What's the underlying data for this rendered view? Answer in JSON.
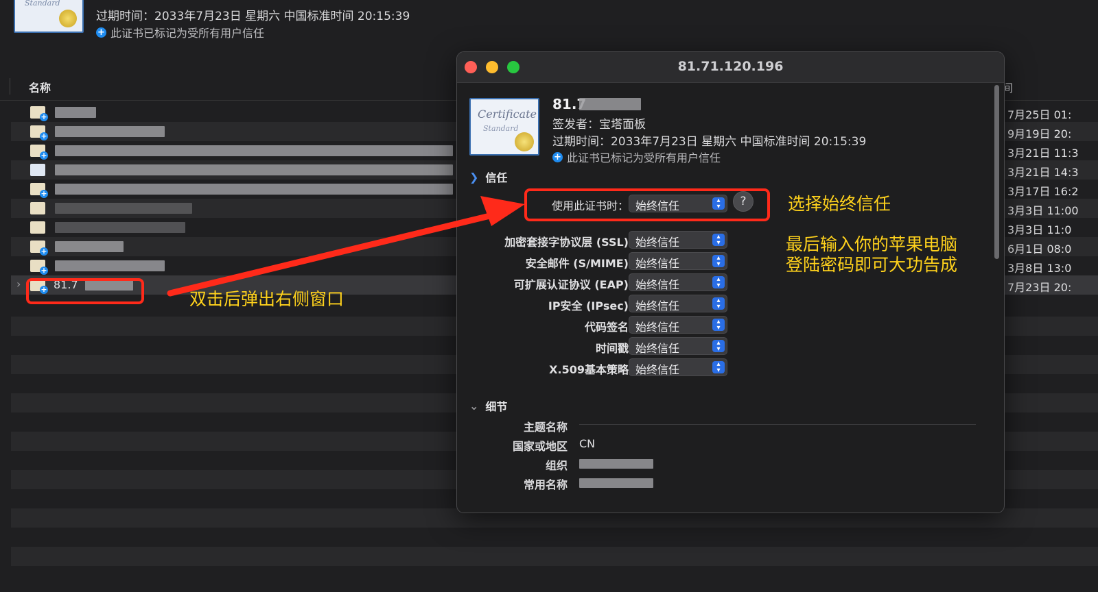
{
  "background": {
    "expiry": "过期时间：2033年7月23日 星期六 中国标准时间 20:15:39",
    "trusted_note": "此证书已标记为受所有用户信任",
    "column_name": "名称",
    "column_right": "间"
  },
  "rows": [
    {
      "name": "",
      "date": "7月25日 01:"
    },
    {
      "name": "",
      "date": "9月19日 20:"
    },
    {
      "name": "",
      "date": "3月21日 11:3"
    },
    {
      "name": "",
      "date": "3月21日 14:3"
    },
    {
      "name": "",
      "date": "3月17日 16:2"
    },
    {
      "name": "",
      "date": "3月3日 11:00"
    },
    {
      "name": "",
      "date": "3月3日 11:0"
    },
    {
      "name": "",
      "date": "6月1日 08:0"
    },
    {
      "name": "",
      "date": "3月8日 13:0"
    },
    {
      "name": "81.7",
      "date": "7月23日 20:"
    }
  ],
  "window": {
    "title": "81.71.120.196",
    "cert_name": "81.7",
    "cert_script": "Certificate",
    "cert_script2": "Standard",
    "issuer": "签发者：宝塔面板",
    "expiry": "过期时间：2033年7月23日 星期六 中国标准时间 20:15:39",
    "trusted_note": "此证书已标记为受所有用户信任",
    "trust_section": "信任",
    "when_using_label": "使用此证书时：",
    "when_using_value": "始终信任",
    "help": "?",
    "trust_items": [
      {
        "label": "加密套接字协议层 (SSL)",
        "value": "始终信任"
      },
      {
        "label": "安全邮件 (S/MIME)",
        "value": "始终信任"
      },
      {
        "label": "可扩展认证协议 (EAP)",
        "value": "始终信任"
      },
      {
        "label": "IP安全 (IPsec)",
        "value": "始终信任"
      },
      {
        "label": "代码签名",
        "value": "始终信任"
      },
      {
        "label": "时间戳",
        "value": "始终信任"
      },
      {
        "label": "X.509基本策略",
        "value": "始终信任"
      }
    ],
    "details_section": "细节",
    "details": [
      {
        "label": "主题名称",
        "value": ""
      },
      {
        "label": "国家或地区",
        "value": "CN"
      },
      {
        "label": "组织",
        "value": ""
      },
      {
        "label": "常用名称",
        "value": ""
      }
    ]
  },
  "annotations": {
    "double_click": "双击后弹出右侧窗口",
    "choose_always": "选择始终信任",
    "final_line1": "最后输入你的苹果电脑",
    "final_line2": "登陆密码即可大功告成",
    "color": "#ffd21c",
    "highlight_color": "#ff2a1a"
  }
}
